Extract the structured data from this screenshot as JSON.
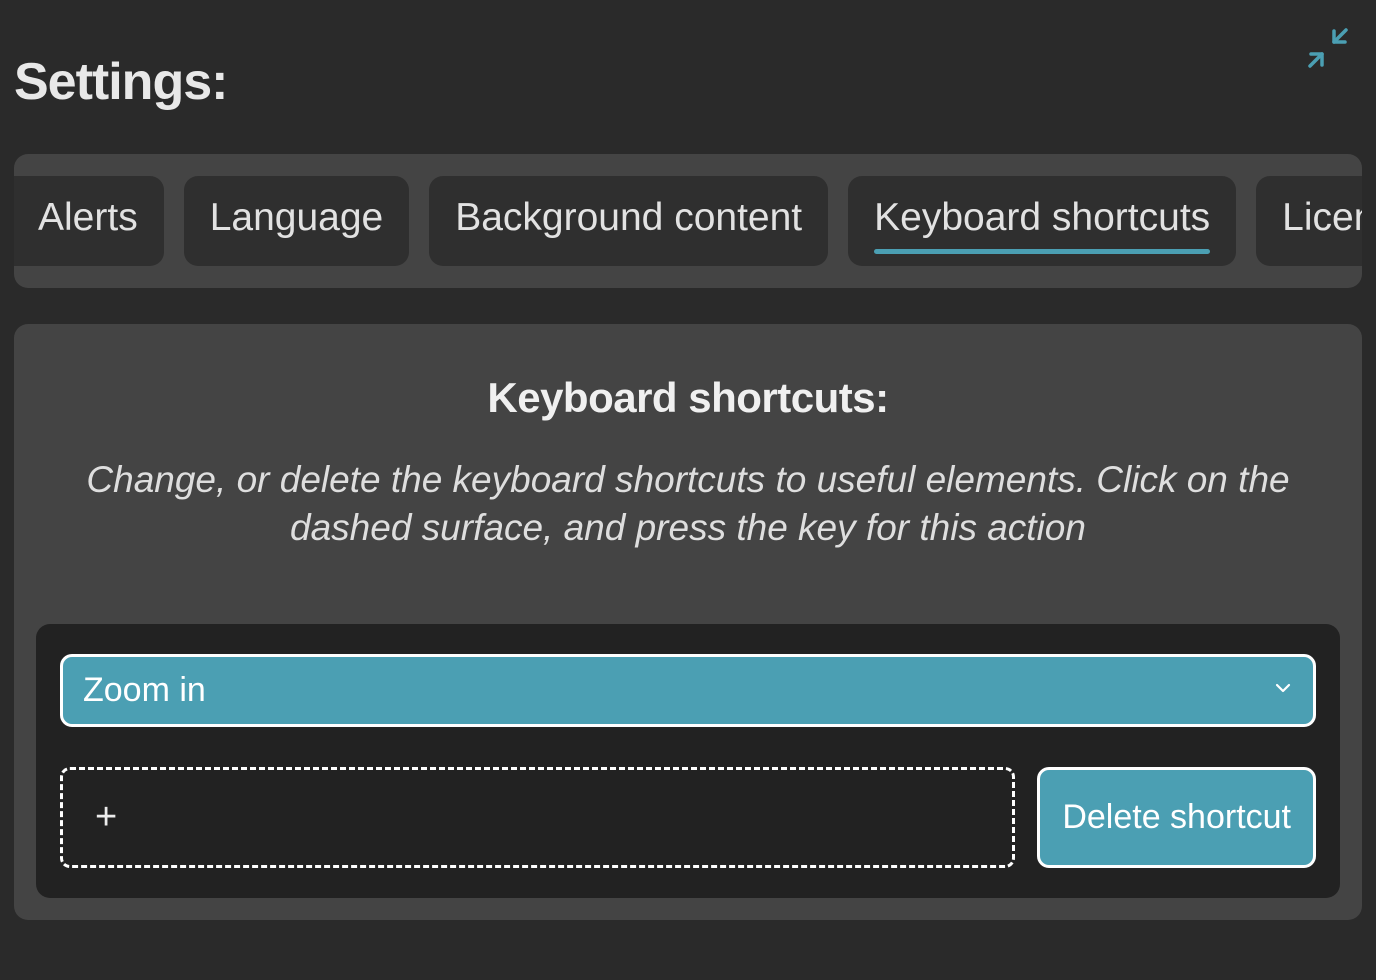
{
  "header": {
    "title": "Settings:"
  },
  "tabs": {
    "items": [
      {
        "label": "Alerts"
      },
      {
        "label": "Language"
      },
      {
        "label": "Background content"
      },
      {
        "label": "Keyboard shortcuts"
      },
      {
        "label": "Licenses"
      }
    ]
  },
  "panel": {
    "title": "Keyboard shortcuts:",
    "description": "Change, or delete the keyboard shortcuts to useful elements. Click on the dashed surface, and press the key for this action"
  },
  "shortcut": {
    "selected_action": "Zoom in",
    "current_key": "+",
    "delete_label": "Delete shortcut"
  },
  "colors": {
    "accent": "#4b9fb3",
    "panel_bg": "#444444",
    "page_bg": "#2a2a2a",
    "inner_bg": "#222222"
  }
}
